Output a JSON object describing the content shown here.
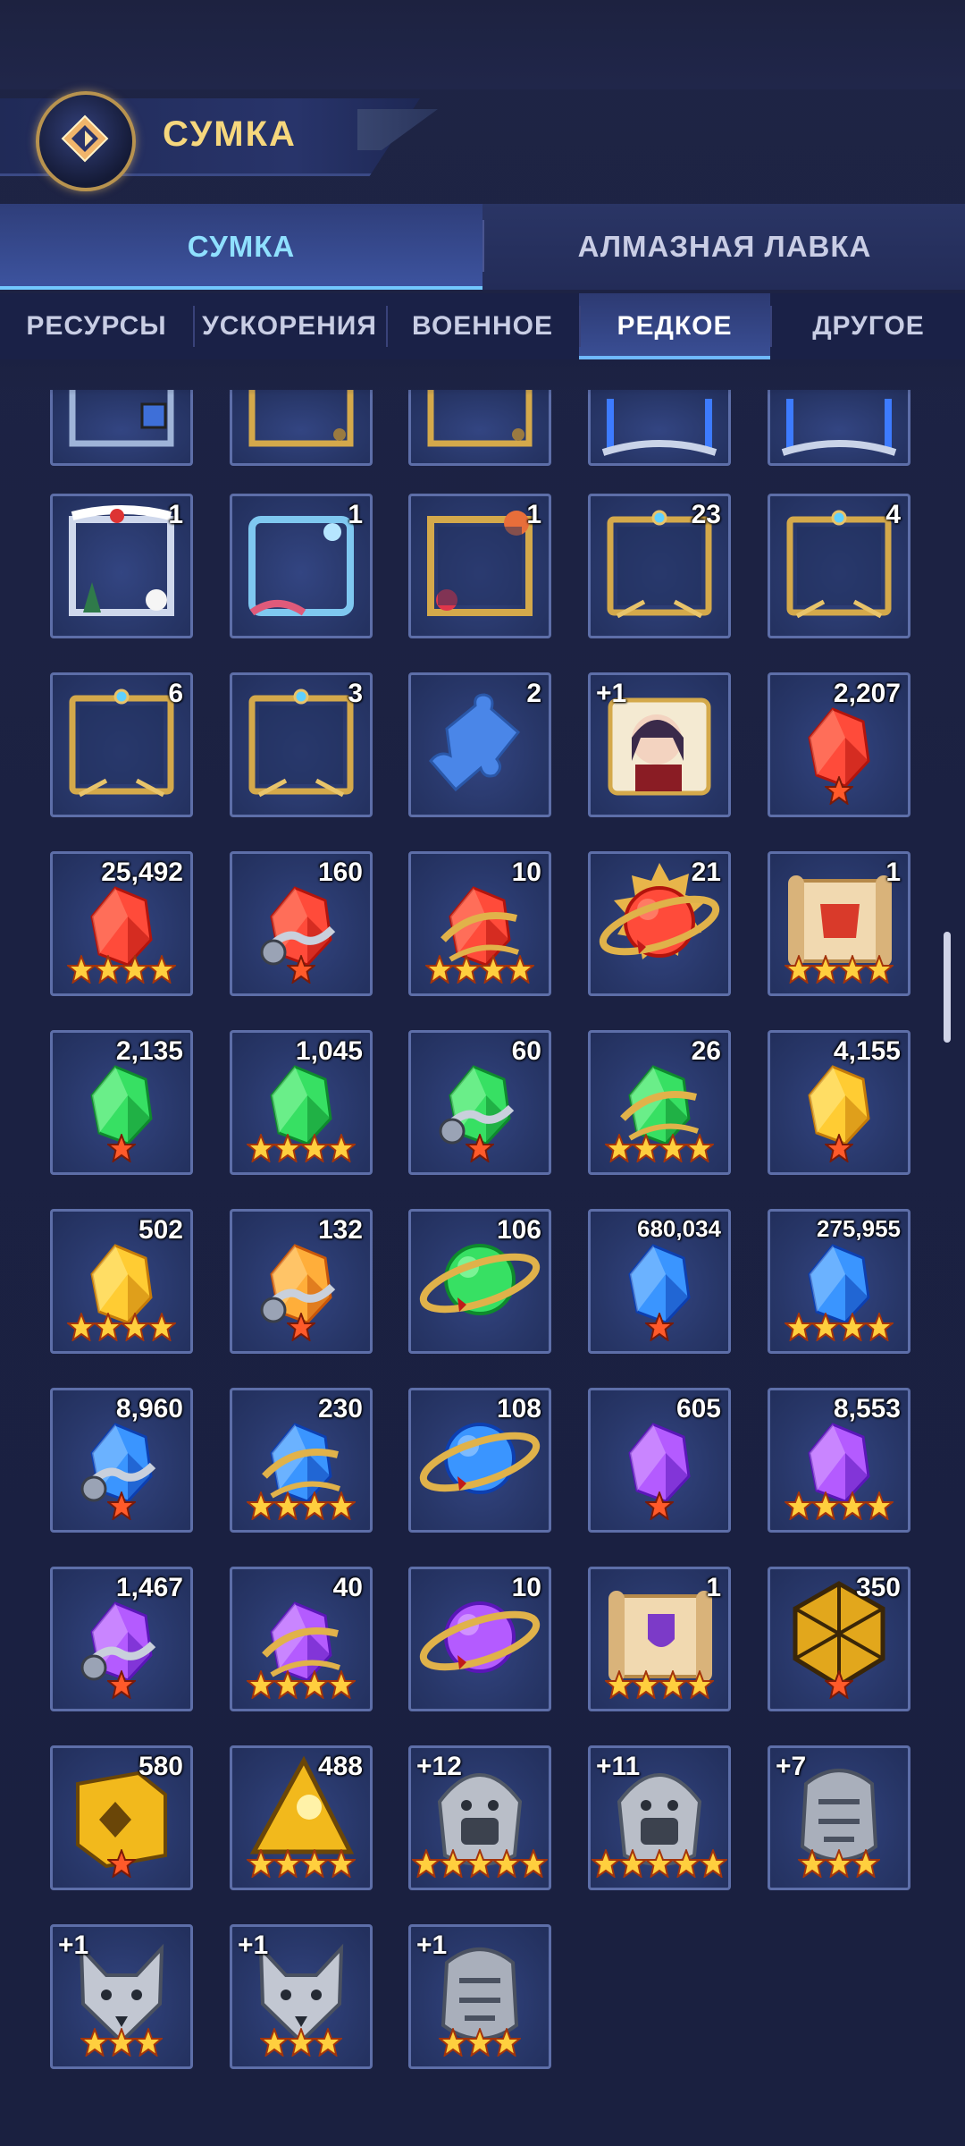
{
  "header": {
    "title": "СУМКА"
  },
  "main_tabs": [
    {
      "label": "СУМКА",
      "active": true
    },
    {
      "label": "АЛМАЗНАЯ ЛАВКА",
      "active": false
    }
  ],
  "sub_tabs": [
    {
      "label": "РЕСУРСЫ",
      "active": false
    },
    {
      "label": "УСКОРЕНИЯ",
      "active": false
    },
    {
      "label": "ВОЕННОЕ",
      "active": false
    },
    {
      "label": "РЕДКОЕ",
      "active": true
    },
    {
      "label": "ДРУГОЕ",
      "active": false
    }
  ],
  "colors": {
    "accent_gold": "#f6d77d",
    "active_tab_text": "#8fe0ff",
    "star": "#ffcf3e",
    "cell_border": "#5d6ea8",
    "background": "#1b2142"
  },
  "items": [
    {
      "name": "avatar-frame-blue-icon",
      "count": "",
      "stars": 0,
      "cut": true
    },
    {
      "name": "avatar-frame-gold-icon",
      "count": "",
      "stars": 0,
      "cut": true
    },
    {
      "name": "avatar-frame-gold-icon",
      "count": "",
      "stars": 0,
      "cut": true
    },
    {
      "name": "avatar-frame-silver-icon",
      "count": "",
      "stars": 0,
      "cut": true
    },
    {
      "name": "avatar-frame-silver-icon",
      "count": "",
      "stars": 0,
      "cut": true
    },
    {
      "name": "christmas-frame-icon",
      "count": "1",
      "stars": 0
    },
    {
      "name": "ocean-frame-icon",
      "count": "1",
      "stars": 0
    },
    {
      "name": "jester-frame-icon",
      "count": "1",
      "stars": 0
    },
    {
      "name": "gold-frame-icon",
      "count": "23",
      "stars": 0
    },
    {
      "name": "gold-frame-icon",
      "count": "4",
      "stars": 0
    },
    {
      "name": "gold-frame-icon",
      "count": "6",
      "stars": 0
    },
    {
      "name": "gold-frame-icon",
      "count": "3",
      "stars": 0
    },
    {
      "name": "puzzle-piece-icon",
      "count": "2",
      "stars": 0
    },
    {
      "name": "hero-sticker-icon",
      "count": "",
      "plus": "+1",
      "stars": 0
    },
    {
      "name": "red-crystal-icon",
      "count": "2,207",
      "stars": 1
    },
    {
      "name": "red-crystal-icon",
      "count": "25,492",
      "stars": 4
    },
    {
      "name": "red-crystal-bound-icon",
      "count": "160",
      "stars": 1
    },
    {
      "name": "red-crystal-ornate-icon",
      "count": "10",
      "stars": 4
    },
    {
      "name": "red-orb-sun-icon",
      "count": "21",
      "stars": 0
    },
    {
      "name": "red-scroll-icon",
      "count": "1",
      "stars": 4
    },
    {
      "name": "green-crystal-icon",
      "count": "2,135",
      "stars": 1
    },
    {
      "name": "green-crystal-icon",
      "count": "1,045",
      "stars": 4
    },
    {
      "name": "green-crystal-bound-icon",
      "count": "60",
      "stars": 1
    },
    {
      "name": "green-crystal-ornate-icon",
      "count": "26",
      "stars": 4
    },
    {
      "name": "yellow-crystal-icon",
      "count": "4,155",
      "stars": 1
    },
    {
      "name": "yellow-crystal-icon",
      "count": "502",
      "stars": 4
    },
    {
      "name": "orange-crystal-bound-icon",
      "count": "132",
      "stars": 1
    },
    {
      "name": "green-orb-ring-icon",
      "count": "106",
      "stars": 0
    },
    {
      "name": "blue-crystal-icon",
      "count": "680,034",
      "stars": 1
    },
    {
      "name": "blue-crystal-icon",
      "count": "275,955",
      "stars": 4
    },
    {
      "name": "blue-crystal-bound-icon",
      "count": "8,960",
      "stars": 1
    },
    {
      "name": "blue-crystal-ornate-icon",
      "count": "230",
      "stars": 4
    },
    {
      "name": "blue-orb-ring-icon",
      "count": "108",
      "stars": 0
    },
    {
      "name": "purple-crystal-icon",
      "count": "605",
      "stars": 1
    },
    {
      "name": "purple-crystal-icon",
      "count": "8,553",
      "stars": 4
    },
    {
      "name": "purple-crystal-bound-icon",
      "count": "1,467",
      "stars": 1
    },
    {
      "name": "purple-crystal-ornate-icon",
      "count": "40",
      "stars": 4
    },
    {
      "name": "purple-orb-ring-icon",
      "count": "10",
      "stars": 0
    },
    {
      "name": "purple-scroll-icon",
      "count": "1",
      "stars": 4
    },
    {
      "name": "gold-icosahedron-icon",
      "count": "350",
      "stars": 1
    },
    {
      "name": "gold-cube-icon",
      "count": "580",
      "stars": 1
    },
    {
      "name": "gold-pyramid-icon",
      "count": "488",
      "stars": 4
    },
    {
      "name": "lion-emblem-icon",
      "count": "",
      "plus": "+12",
      "stars": 5
    },
    {
      "name": "lion-emblem-icon",
      "count": "",
      "plus": "+11",
      "stars": 5
    },
    {
      "name": "eagle-emblem-icon",
      "count": "",
      "plus": "+7",
      "stars": 3
    },
    {
      "name": "wolf-emblem-icon",
      "count": "",
      "plus": "+1",
      "stars": 3
    },
    {
      "name": "wolf-emblem-icon",
      "count": "",
      "plus": "+1",
      "stars": 3
    },
    {
      "name": "eagle-emblem-icon",
      "count": "",
      "plus": "+1",
      "stars": 3
    }
  ]
}
